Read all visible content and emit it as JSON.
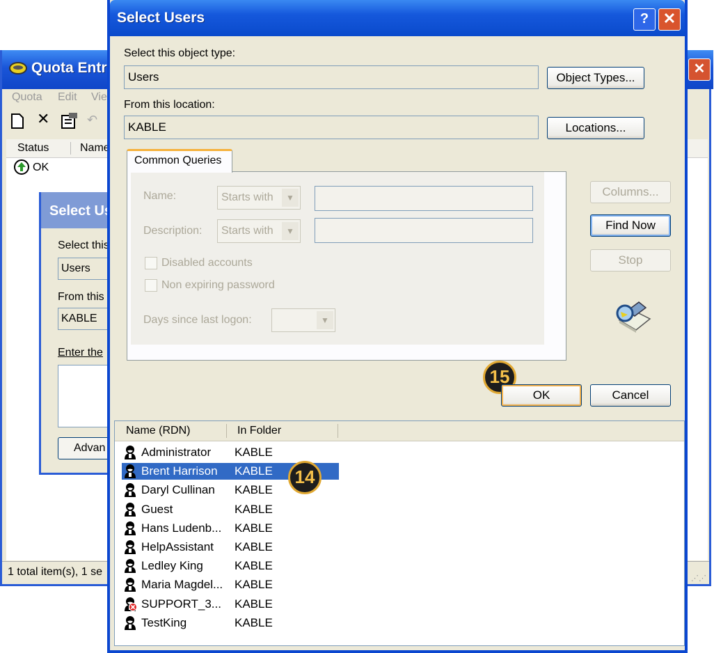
{
  "quota_window": {
    "title": "Quota Entri",
    "close_glyph": "✕",
    "menu": [
      "Quota",
      "Edit",
      "Vie"
    ],
    "list_headers": [
      "Status",
      "Name"
    ],
    "row_status": "OK",
    "status_text": "1 total item(s), 1 se"
  },
  "inner_dialog": {
    "title": "Select Us",
    "object_type_label": "Select this",
    "object_type_value": "Users",
    "location_label": "From this l",
    "location_value": "KABLE",
    "enter_label": "Enter the",
    "advanced_label": "Advan"
  },
  "dialog": {
    "title": "Select Users",
    "help_glyph": "?",
    "close_glyph": "✕",
    "object_type_label": "Select this object type:",
    "object_type_value": "Users",
    "object_types_button": "Object Types...",
    "location_label": "From this location:",
    "location_value": "KABLE",
    "locations_button": "Locations...",
    "tab_label": "Common Queries",
    "name_label": "Name:",
    "name_mode": "Starts with",
    "description_label": "Description:",
    "description_mode": "Starts with",
    "disabled_accounts_label": "Disabled accounts",
    "non_expiring_label": "Non expiring password",
    "days_label": "Days since last logon:",
    "columns_button": "Columns...",
    "find_now_button": "Find Now",
    "stop_button": "Stop",
    "ok_button": "OK",
    "cancel_button": "Cancel",
    "results_headers": [
      "Name (RDN)",
      "In Folder"
    ],
    "results": [
      {
        "name": "Administrator",
        "folder": "KABLE",
        "icon": "user-icon"
      },
      {
        "name": "Brent Harrison",
        "folder": "KABLE",
        "icon": "user-icon",
        "selected": true
      },
      {
        "name": "Daryl Cullinan",
        "folder": "KABLE",
        "icon": "user-icon"
      },
      {
        "name": "Guest",
        "folder": "KABLE",
        "icon": "user-icon"
      },
      {
        "name": "Hans Ludenb...",
        "folder": "KABLE",
        "icon": "user-icon"
      },
      {
        "name": "HelpAssistant",
        "folder": "KABLE",
        "icon": "user-icon"
      },
      {
        "name": "Ledley King",
        "folder": "KABLE",
        "icon": "user-icon"
      },
      {
        "name": "Maria Magdel...",
        "folder": "KABLE",
        "icon": "user-icon"
      },
      {
        "name": "SUPPORT_3...",
        "folder": "KABLE",
        "icon": "disabled-user-icon"
      },
      {
        "name": "TestKing",
        "folder": "KABLE",
        "icon": "user-icon"
      }
    ]
  },
  "callouts": {
    "step_ok": "15",
    "step_select": "14"
  },
  "colors": {
    "titlebar": "#0a4acb",
    "selection": "#316ac5",
    "callout_ring": "#e1a933"
  }
}
